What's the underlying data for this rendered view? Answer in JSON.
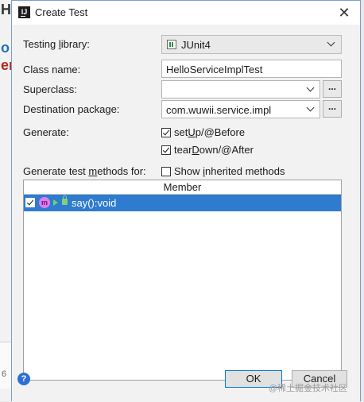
{
  "background": {
    "chars": [
      "H",
      "o",
      "er"
    ],
    "bottom_text": "6"
  },
  "dialog": {
    "title": "Create Test",
    "app_icon_text": "IJ",
    "close_glyph": "✕"
  },
  "form": {
    "testing_library": {
      "label": "Testing library:",
      "underline_char": "l",
      "value": "JUnit4"
    },
    "class_name": {
      "label": "Class name:",
      "value": "HelloServiceImplTest"
    },
    "superclass": {
      "label": "Superclass:",
      "value": ""
    },
    "destination_package": {
      "label": "Destination package:",
      "value": "com.wuwii.service.impl"
    },
    "generate": {
      "label": "Generate:",
      "setup": {
        "label": "setUp/@Before",
        "checked": true
      },
      "teardown": {
        "label": "tearDown/@After",
        "checked": true
      }
    },
    "generate_methods": {
      "label": "Generate test methods for:",
      "show_inherited": {
        "label": "Show inherited methods",
        "checked": false
      }
    },
    "dots_label": "..."
  },
  "table": {
    "header": "Member",
    "rows": [
      {
        "badge": "m",
        "text": "say():void",
        "checked": true,
        "selected": true
      }
    ]
  },
  "buttons": {
    "help": "?",
    "ok": "OK",
    "cancel": "Cancel"
  },
  "watermark": "@稀土掘金技术社区",
  "colors": {
    "selection": "#2e7bcf",
    "accent": "#0078d7"
  }
}
